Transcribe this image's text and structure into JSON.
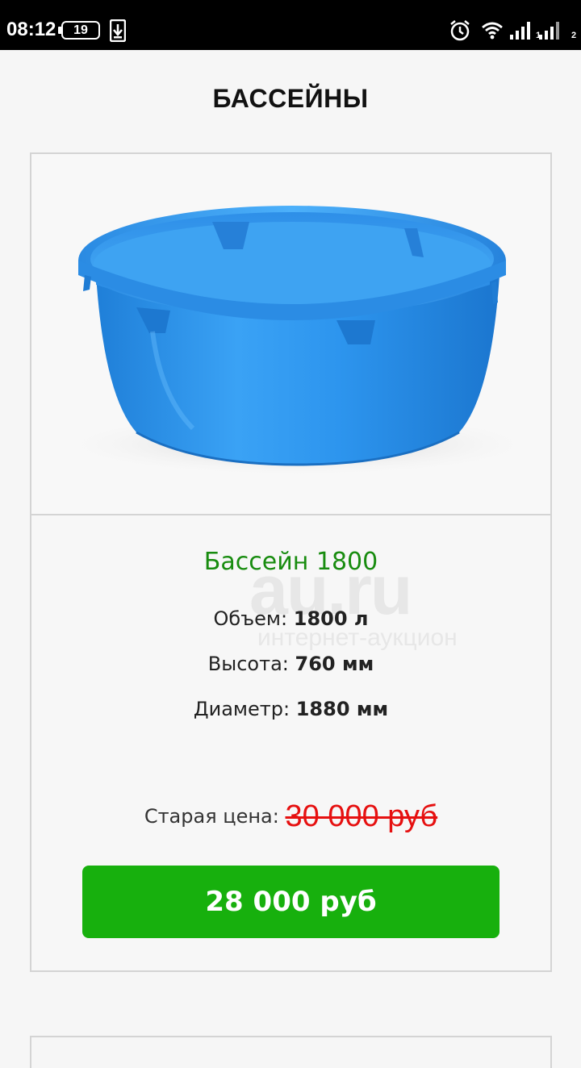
{
  "status_bar": {
    "time": "08:12",
    "battery": "19",
    "sim1": "1",
    "sim2": "2",
    "icons": [
      "download-icon",
      "alarm-icon",
      "wifi-icon",
      "signal-icon",
      "signal-icon"
    ]
  },
  "page": {
    "title": "БАССЕЙНЫ"
  },
  "product": {
    "name": "Бассейн 1800",
    "specs": {
      "volume_label": "Объем:",
      "volume_value": "1800 л",
      "height_label": "Высота:",
      "height_value": "760 мм",
      "diameter_label": "Диаметр:",
      "diameter_value": "1880 мм"
    },
    "old_price_label": "Старая цена:",
    "old_price_value": "30 000 руб",
    "price": "28 000 руб"
  },
  "watermark": {
    "brand": "au.ru",
    "tagline": "интернет-аукцион"
  },
  "colors": {
    "product_name": "#188c0f",
    "price_button": "#17b00d",
    "old_price": "#e61010",
    "pool_blue": "#2a8fe6"
  }
}
